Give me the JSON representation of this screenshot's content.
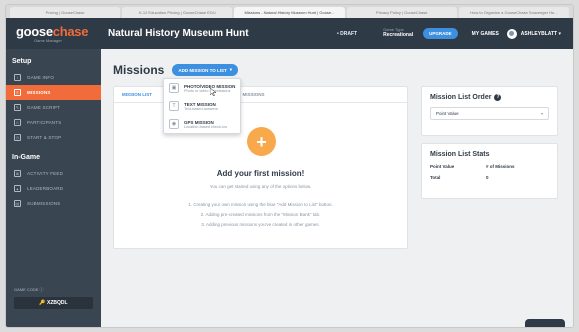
{
  "browser": {
    "tabs": [
      {
        "label": "Pricing | GooseChase"
      },
      {
        "label": "K-12 Education Pricing | GooseChase EDU"
      },
      {
        "label": "Missions - Natural History Museum Hunt | Goose..."
      },
      {
        "label": "Privacy Policy | GooseChase"
      },
      {
        "label": "How to Organize a GooseChase Scavenger Hu..."
      }
    ]
  },
  "topbar": {
    "logo_goose": "goose",
    "logo_chase": "chase",
    "logo_sub": "Game Manager",
    "game_title": "Natural History Museum Hunt",
    "status": "• DRAFT",
    "game_type_label": "Game Type",
    "game_type_value": "Recreational",
    "upgrade_label": "UPGRADE",
    "my_games_label": "MY GAMES",
    "username": "ASHLEYBLATT ▾"
  },
  "sidebar": {
    "setup_title": "Setup",
    "setup_items": [
      {
        "label": "GAME INFO",
        "icon": "info-icon"
      },
      {
        "label": "MISSIONS",
        "icon": "list-icon"
      },
      {
        "label": "GAME SCRIPT",
        "icon": "script-icon"
      },
      {
        "label": "PARTICIPANTS",
        "icon": "people-icon"
      },
      {
        "label": "START & STOP",
        "icon": "clock-icon"
      }
    ],
    "ingame_title": "In-Game",
    "ingame_items": [
      {
        "label": "ACTIVITY FEED",
        "icon": "feed-icon"
      },
      {
        "label": "LEADERBOARD",
        "icon": "leaderboard-icon"
      },
      {
        "label": "SUBMISSIONS",
        "icon": "submissions-icon"
      }
    ],
    "game_code_label": "GAME CODE ⓘ",
    "game_code": "🔑 XZBQDL"
  },
  "main": {
    "title": "Missions",
    "add_button": "ADD MISSION TO LIST",
    "tabs": [
      {
        "label": "MISSION LIST"
      },
      {
        "label": "PREVIOUS MISSIONS"
      }
    ],
    "empty_title": "Add your first mission!",
    "empty_sub": "You can get started using any of the options below.",
    "steps": [
      "1. Creating your own mission using the blue \"Add Mission to List\" button.",
      "2. Adding pre-created missions from the \"Mission Bank\" tab.",
      "3. Adding previous missions you've created in other games."
    ],
    "dropdown": [
      {
        "title": "PHOTO/VIDEO MISSION",
        "sub": "Photo or video submissions",
        "glyph": "▣"
      },
      {
        "title": "TEXT MISSION",
        "sub": "Text-based answers",
        "glyph": "T"
      },
      {
        "title": "GPS MISSION",
        "sub": "Location-based check-ins",
        "glyph": "◉"
      }
    ]
  },
  "order_card": {
    "title": "Mission List Order",
    "select_value": "Point Value"
  },
  "stats_card": {
    "title": "Mission List Stats",
    "col1": "Point Value",
    "col2": "# of Missions",
    "row_label": "Total",
    "row_value": "0"
  },
  "colors": {
    "accent_orange": "#f26b3a",
    "accent_blue": "#3d8fe0",
    "sidebar": "#3a4552",
    "topbar": "#2f3a47"
  }
}
